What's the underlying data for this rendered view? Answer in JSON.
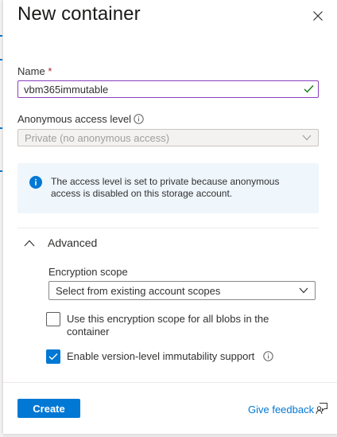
{
  "panel": {
    "title": "New container",
    "close_icon": "close-icon"
  },
  "name_field": {
    "label": "Name",
    "required_marker": "*",
    "value": "vbm365immutable",
    "valid_icon": "checkmark-icon"
  },
  "access_level": {
    "label": "Anonymous access level",
    "info_icon": "info-icon",
    "selected": "Private (no anonymous access)",
    "disabled": true
  },
  "info_message": {
    "icon": "info-filled-icon",
    "text": "The access level is set to private because anonymous access is disabled on this storage account."
  },
  "advanced": {
    "label": "Advanced",
    "expanded": true,
    "encryption_scope": {
      "label": "Encryption scope",
      "placeholder": "Select from existing account scopes"
    },
    "use_scope_for_all_blobs": {
      "label": "Use this encryption scope for all blobs in the container",
      "checked": false
    },
    "version_immutability": {
      "label": "Enable version-level immutability support",
      "checked": true,
      "info_icon": "info-icon"
    }
  },
  "footer": {
    "create_label": "Create",
    "feedback_label": "Give feedback",
    "feedback_icon": "feedback-person-icon"
  },
  "colors": {
    "accent": "#0078d4",
    "focus_border": "#8a3fbf",
    "valid": "#107c10",
    "info_bg": "#eff6fc",
    "required": "#a4262c"
  }
}
